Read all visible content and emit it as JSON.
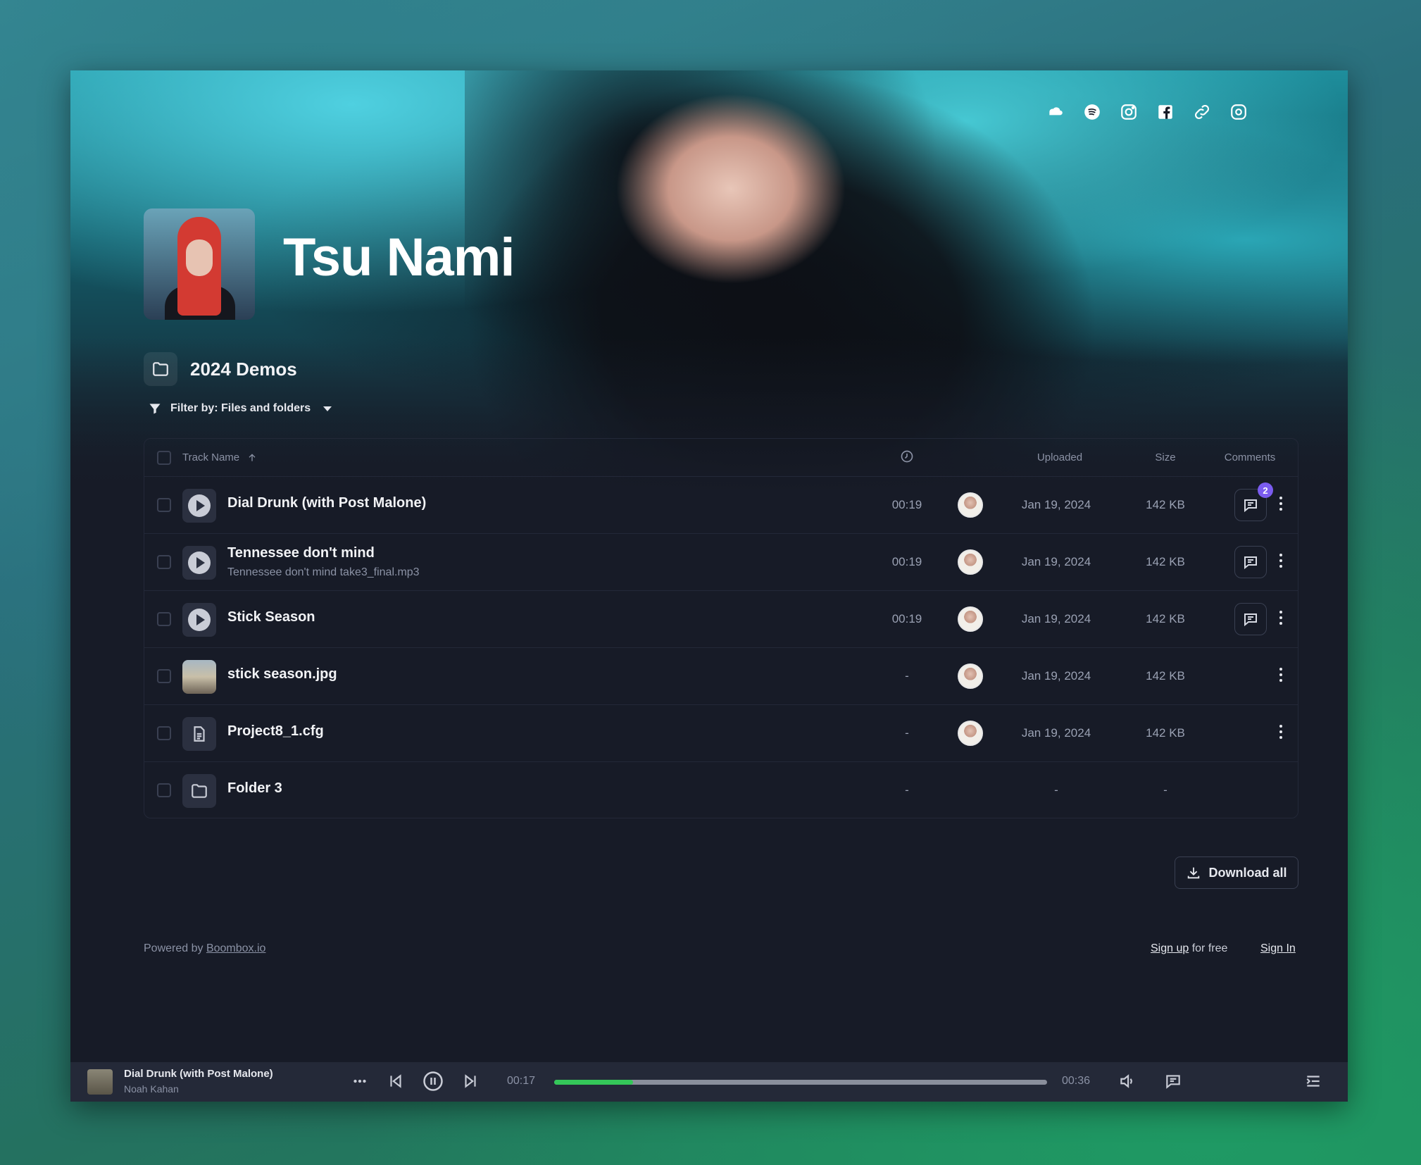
{
  "artist": {
    "name": "Tsu Nami"
  },
  "social_icons": [
    "soundcloud-icon",
    "spotify-icon",
    "instagram-icon",
    "facebook-icon",
    "link-icon",
    "settings-icon"
  ],
  "folder": {
    "title": "2024 Demos"
  },
  "filter": {
    "label": "Filter by: Files and folders"
  },
  "table": {
    "headers": {
      "name": "Track Name",
      "uploaded": "Uploaded",
      "size": "Size",
      "comments": "Comments"
    },
    "rows": [
      {
        "kind": "track",
        "title": "Dial Drunk (with Post Malone)",
        "subtitle": "",
        "duration": "00:19",
        "uploaded": "Jan 19, 2024",
        "size": "142 KB",
        "comments": "2",
        "has_comments": true
      },
      {
        "kind": "track",
        "title": "Tennessee don't mind",
        "subtitle": "Tennessee don't mind take3_final.mp3",
        "duration": "00:19",
        "uploaded": "Jan 19, 2024",
        "size": "142 KB",
        "comments": "",
        "has_comments": true
      },
      {
        "kind": "track",
        "title": "Stick Season",
        "subtitle": "",
        "duration": "00:19",
        "uploaded": "Jan 19, 2024",
        "size": "142 KB",
        "comments": "",
        "has_comments": true
      },
      {
        "kind": "image",
        "title": "stick season.jpg",
        "subtitle": "",
        "duration": "-",
        "uploaded": "Jan 19, 2024",
        "size": "142 KB",
        "comments": "",
        "has_comments": false
      },
      {
        "kind": "file",
        "title": "Project8_1.cfg",
        "subtitle": "",
        "duration": "-",
        "uploaded": "Jan 19, 2024",
        "size": "142 KB",
        "comments": "",
        "has_comments": false
      },
      {
        "kind": "folder",
        "title": "Folder 3",
        "subtitle": "",
        "duration": "-",
        "uploaded": "-",
        "size": "-",
        "comments": "",
        "has_comments": false
      }
    ]
  },
  "download_all": "Download all",
  "footer": {
    "powered_prefix": "Powered by ",
    "powered_link": "Boombox.io",
    "signup_link": "Sign up",
    "signup_suffix": " for free",
    "signin": "Sign In"
  },
  "player": {
    "title": "Dial Drunk (with Post Malone)",
    "artist": "Noah Kahan",
    "elapsed": "00:17",
    "total": "00:36",
    "progress": 0.16
  },
  "colors": {
    "background": "#171b27",
    "accent_progress": "#34c759",
    "badge": "#7b5cf0"
  }
}
